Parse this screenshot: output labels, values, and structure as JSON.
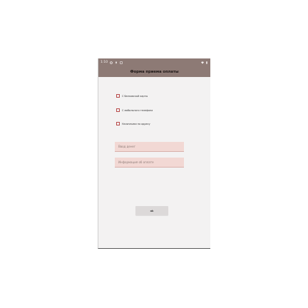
{
  "status_bar": {
    "time": "1:10",
    "left_icons": [
      "settings-icon",
      "location-icon",
      "screen-icon"
    ],
    "right_icons": [
      "wifi-icon",
      "battery-icon"
    ]
  },
  "app_bar": {
    "title": "Форма приема оплаты"
  },
  "options": [
    {
      "label": "С банковской карты"
    },
    {
      "label": "С мобильного телефона"
    },
    {
      "label": "Наличными по адресу"
    }
  ],
  "fields": {
    "amount": {
      "placeholder": "Ввод денег",
      "value": ""
    },
    "info": {
      "placeholder": "Информация об оплате",
      "value": ""
    }
  },
  "ok_button": {
    "label": "ok"
  },
  "colors": {
    "accent": "#8d7a75",
    "checkbox_border": "#b84b4b",
    "field_bg": "#f2d8d4",
    "button_bg": "#dcd9d9"
  }
}
